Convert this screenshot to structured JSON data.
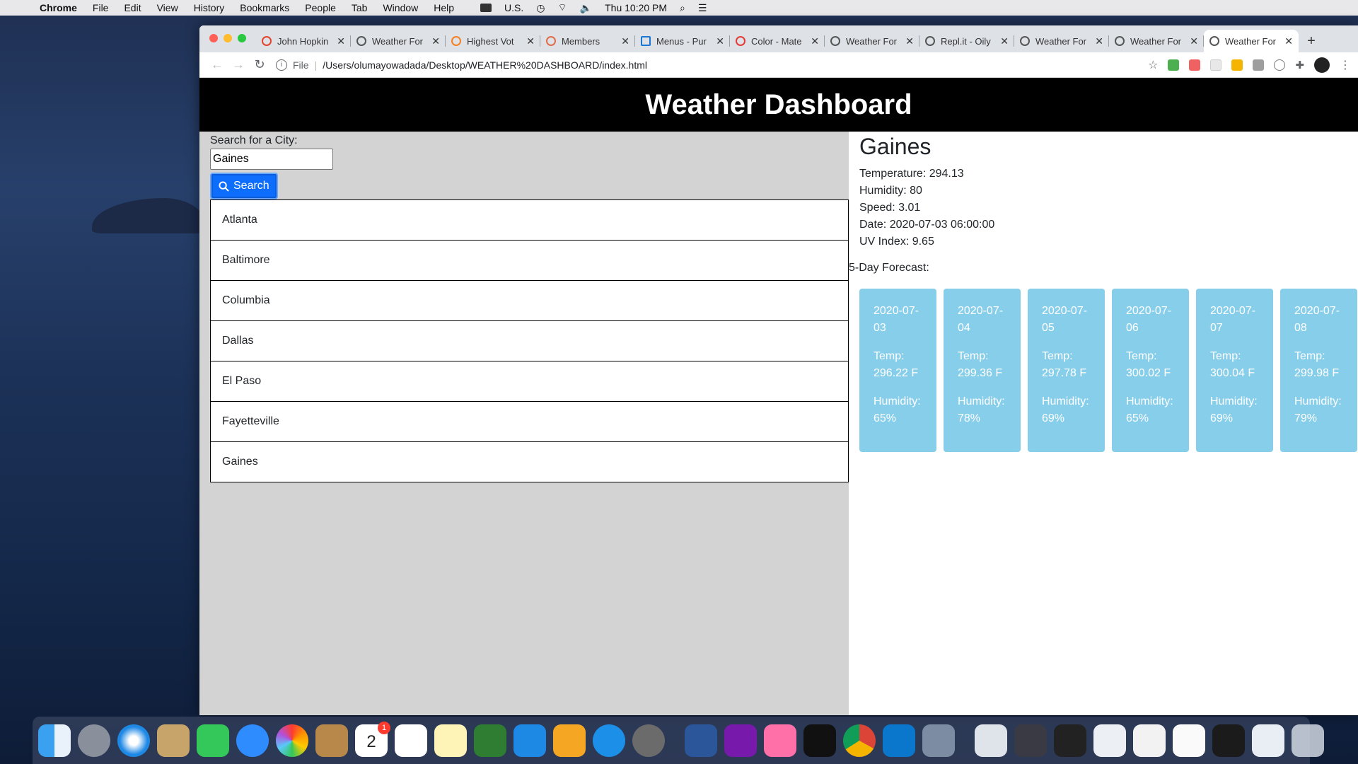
{
  "menubar": {
    "app": "Chrome",
    "items": [
      "File",
      "Edit",
      "View",
      "History",
      "Bookmarks",
      "People",
      "Tab",
      "Window",
      "Help"
    ],
    "input_source": "U.S.",
    "clock": "Thu 10:20 PM"
  },
  "tabs": [
    {
      "title": "John Hopkin",
      "icon": "gitlab-icon",
      "active": false
    },
    {
      "title": "Weather For",
      "icon": "globe-icon",
      "active": false
    },
    {
      "title": "Highest Vot",
      "icon": "stackoverflow-icon",
      "active": false
    },
    {
      "title": "Members",
      "icon": "members-icon",
      "active": false
    },
    {
      "title": "Menus - Pur",
      "icon": "p-icon",
      "active": false
    },
    {
      "title": "Color - Mate",
      "icon": "material-icon",
      "active": false
    },
    {
      "title": "Weather For",
      "icon": "globe-icon",
      "active": false
    },
    {
      "title": "Repl.it - Oily",
      "icon": "replit-icon",
      "active": false
    },
    {
      "title": "Weather For",
      "icon": "globe-icon",
      "active": false
    },
    {
      "title": "Weather For",
      "icon": "globe-icon",
      "active": false
    },
    {
      "title": "Weather For",
      "icon": "globe-icon",
      "active": true
    }
  ],
  "omnibox": {
    "scheme": "File",
    "url": "/Users/olumayowadada/Desktop/WEATHER%20DASHBOARD/index.html"
  },
  "page": {
    "header": "Weather Dashboard",
    "search_label": "Search for a City:",
    "search_value": "Gaines",
    "search_button": "Search",
    "cities": [
      "Atlanta",
      "Baltimore",
      "Columbia",
      "Dallas",
      "El Paso",
      "Fayetteville",
      "Gaines"
    ],
    "current": {
      "city": "Gaines",
      "temperature": "Temperature: 294.13",
      "humidity": "Humidity: 80",
      "speed": "Speed: 3.01",
      "date": "Date: 2020-07-03 06:00:00",
      "uv": "UV Index: 9.65"
    },
    "forecast_title": "5-Day Forecast:",
    "forecast": [
      {
        "date": "2020-07-03",
        "temp": "Temp: 296.22 F",
        "humidity": "Humidity: 65%"
      },
      {
        "date": "2020-07-04",
        "temp": "Temp: 299.36 F",
        "humidity": "Humidity: 78%"
      },
      {
        "date": "2020-07-05",
        "temp": "Temp: 297.78 F",
        "humidity": "Humidity: 69%"
      },
      {
        "date": "2020-07-06",
        "temp": "Temp: 300.02 F",
        "humidity": "Humidity: 65%"
      },
      {
        "date": "2020-07-07",
        "temp": "Temp: 300.04 F",
        "humidity": "Humidity: 69%"
      },
      {
        "date": "2020-07-08",
        "temp": "Temp: 299.98 F",
        "humidity": "Humidity: 79%"
      }
    ]
  },
  "dock": {
    "calendar_badge": "1",
    "calendar_day": "2"
  },
  "colors": {
    "header_bg": "#000000",
    "left_panel_bg": "#d3d3d3",
    "card_bg": "#87ceeb",
    "search_button_bg": "#0d6efd"
  }
}
